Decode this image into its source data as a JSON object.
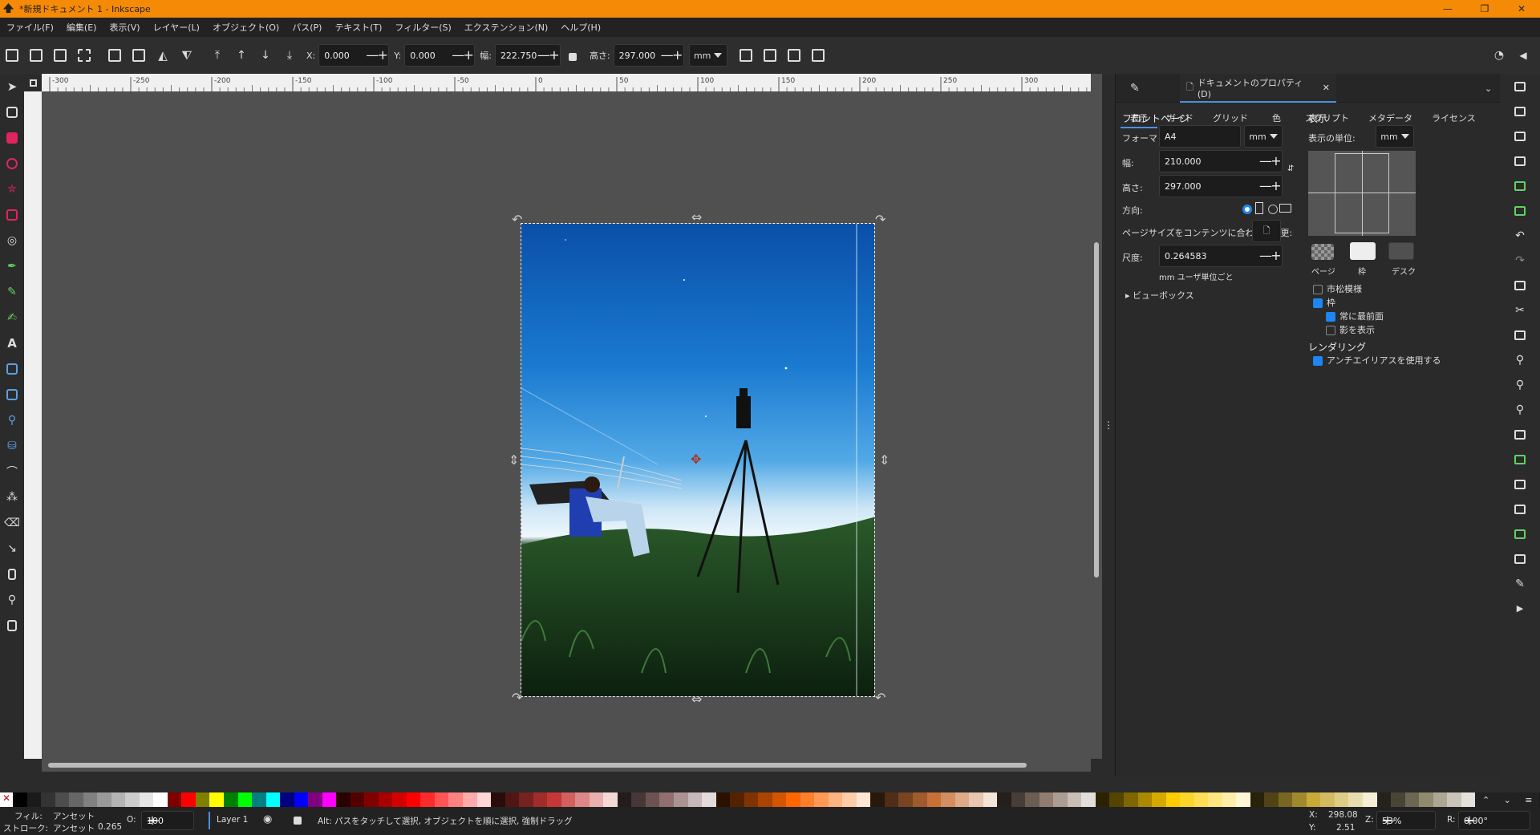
{
  "window": {
    "title": "*新規ドキュメント 1 - Inkscape",
    "minimize": "—",
    "maximize": "❐",
    "close": "✕"
  },
  "menu": [
    "ファイル(F)",
    "編集(E)",
    "表示(V)",
    "レイヤー(L)",
    "オブジェクト(O)",
    "パス(P)",
    "テキスト(T)",
    "フィルター(S)",
    "エクステンション(N)",
    "ヘルプ(H)"
  ],
  "toolbar": {
    "x_label": "X:",
    "x_value": "0.000",
    "y_label": "Y:",
    "y_value": "0.000",
    "w_label": "幅:",
    "w_value": "222.750",
    "h_label": "高さ:",
    "h_value": "297.000",
    "unit": "mm",
    "minus": "—",
    "plus": "+"
  },
  "ruler": {
    "top_ticks": [
      "-300",
      "-250",
      "-200",
      "-150",
      "-100",
      "-50",
      "0",
      "50",
      "100",
      "150",
      "200",
      "250",
      "300"
    ]
  },
  "dock": {
    "doc_props_tab": "ドキュメントのプロパティ(D)",
    "subtabs": [
      "表示",
      "ガイド",
      "グリッド",
      "色",
      "スクリプト",
      "メタデータ",
      "ライセンス"
    ],
    "front_page": "フロントページ",
    "format_label": "フォーマット:",
    "format_value": "A4",
    "format_unit": "mm",
    "width_label": "幅:",
    "width_value": "210.000",
    "height_label": "高さ:",
    "height_value": "297.000",
    "orientation_label": "方向:",
    "resize_label": "ページサイズをコンテンツに合わせて変更:",
    "scale_label": "尺度:",
    "scale_value": "0.264583",
    "user_units": "mm ユーザ単位ごと",
    "viewbox": "ビューボックス",
    "display": "表示",
    "display_units_label": "表示の単位:",
    "display_units_value": "mm",
    "swatch_page": "ページ",
    "swatch_border": "枠",
    "swatch_desk": "デスク",
    "checkerboard": "市松模様",
    "border": "枠",
    "always_front": "常に最前面",
    "show_shadow": "影を表示",
    "rendering": "レンダリング",
    "antialias": "アンチエイリアスを使用する"
  },
  "status": {
    "fill_label": "フィル:",
    "fill_value": "アンセット",
    "stroke_label": "ストローク:",
    "stroke_value": "アンセット",
    "stroke_width": "0.265",
    "opacity_label": "O:",
    "opacity_value": "100",
    "layer": "Layer 1",
    "message": "Alt: パスをタッチして選択, オブジェクトを順に選択, 強制ドラッグ",
    "x_label": "X:",
    "x_value": "298.08",
    "y_label": "Y:",
    "y_value": "2.51",
    "zoom_label": "Z:",
    "zoom_value": "53%",
    "rotate_label": "R:",
    "rotate_value": "0.00°"
  },
  "colors": {
    "accent": "#f58a07",
    "selection": "#1e86f0"
  }
}
